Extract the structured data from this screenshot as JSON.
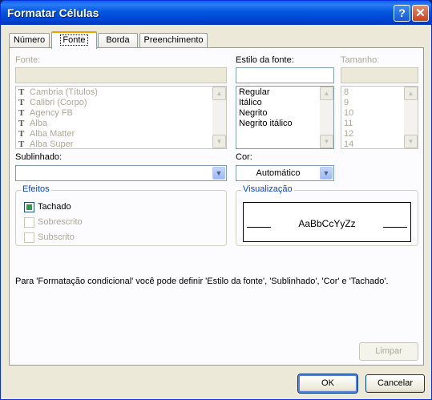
{
  "window": {
    "title": "Formatar Células",
    "help_label": "?",
    "close_label": "✕"
  },
  "tabs": [
    {
      "label": "Número"
    },
    {
      "label": "Fonte"
    },
    {
      "label": "Borda"
    },
    {
      "label": "Preenchimento"
    }
  ],
  "font": {
    "label": "Fonte:",
    "value": "",
    "items": [
      "Cambria (Títulos)",
      "Calibri (Corpo)",
      "Agency FB",
      "Alba",
      "Alba Matter",
      "Alba Super"
    ],
    "item_icon": "truetype-font-icon",
    "item_icon_glyph": "T"
  },
  "style": {
    "label": "Estilo da fonte:",
    "value": "",
    "items": [
      "Regular",
      "Itálico",
      "Negrito",
      "Negrito itálico"
    ]
  },
  "size": {
    "label": "Tamanho:",
    "value": "",
    "items": [
      "8",
      "9",
      "10",
      "11",
      "12",
      "14"
    ]
  },
  "underline": {
    "label": "Sublinhado:",
    "value": ""
  },
  "color": {
    "label": "Cor:",
    "value": "Automático"
  },
  "effects": {
    "title": "Efeitos",
    "options": [
      {
        "label": "Tachado",
        "checked": "indeterminate",
        "enabled": true
      },
      {
        "label": "Sobrescrito",
        "checked": false,
        "enabled": false
      },
      {
        "label": "Subscrito",
        "checked": false,
        "enabled": false
      }
    ]
  },
  "preview": {
    "title": "Visualização",
    "sample": "AaBbCcYyZz"
  },
  "info_text": "Para 'Formatação condicional' você pode definir 'Estilo da fonte', 'Sublinhado', 'Cor' e 'Tachado'.",
  "buttons": {
    "clear": "Limpar",
    "ok": "OK",
    "cancel": "Cancelar"
  },
  "icons": {
    "scroll_up": "▲",
    "scroll_down": "▼",
    "dropdown": "▼"
  },
  "colors": {
    "title_bar": "#0054e3",
    "dialog_bg": "#ece9d8",
    "tab_highlight": "#f4a000",
    "group_title": "#0046d5",
    "check_fill": "#2d9a46"
  }
}
